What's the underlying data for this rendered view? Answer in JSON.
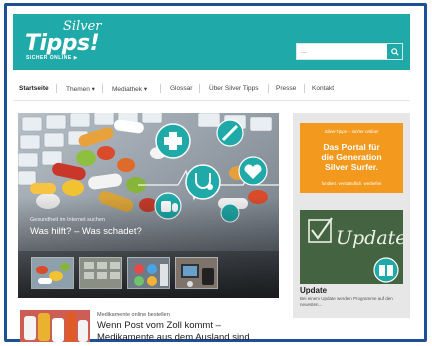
{
  "header": {
    "logo_silver": "Silver",
    "logo_tipps": "Tipps!",
    "logo_tagline": "SICHER ONLINE",
    "search_placeholder": "...",
    "brand_color": "#1fa9a8"
  },
  "nav": {
    "items": [
      {
        "label": "Startseite",
        "dropdown": false,
        "active": true
      },
      {
        "label": "Themen",
        "dropdown": true,
        "active": false
      },
      {
        "label": "Mediathek",
        "dropdown": true,
        "active": false
      },
      {
        "label": "Glossar",
        "dropdown": false,
        "active": false
      },
      {
        "label": "Über Silver Tipps",
        "dropdown": false,
        "active": false
      },
      {
        "label": "Presse",
        "dropdown": false,
        "active": false
      },
      {
        "label": "Kontakt",
        "dropdown": false,
        "active": false
      }
    ],
    "dropdown_marker": "▾"
  },
  "hero": {
    "kicker": "Gesundheit im Internet suchen",
    "title": "Was hilft? – Was schadet?",
    "thumbnails": [
      "pills-thumb",
      "keyboard-thumb",
      "apps-thumb",
      "gadgets-thumb"
    ]
  },
  "sidebar": {
    "promo_small": "SilverTipps – sicher online!",
    "promo_line1": "Das Portal für",
    "promo_line2": "die Generation",
    "promo_line3": "Silver Surfer.",
    "promo_foot": "fundiert. verständlich. werbefrei",
    "promo_color": "#f39a1e",
    "update_img_word": "Update",
    "update_title": "Update",
    "update_text": "Bei einem Update werden Programme auf den neuesten..."
  },
  "teaser": {
    "kicker": "Medikamente online bestellen",
    "title_line1": "Wenn Post vom Zoll kommt –",
    "title_line2": "Medikamente aus dem Ausland sind"
  }
}
